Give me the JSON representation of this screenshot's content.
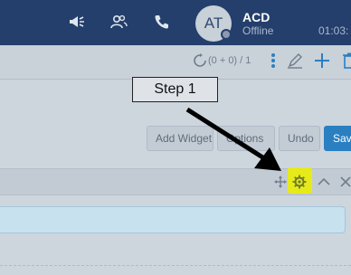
{
  "topbar": {
    "avatar_initials": "AT",
    "user_name": "ACD",
    "user_status": "Offline",
    "clock": "01:03:",
    "icons": [
      "megaphone-icon",
      "contacts-icon",
      "phone-icon"
    ]
  },
  "toolbar": {
    "counter": "(0 + 0) / 1",
    "icons": [
      "refresh-icon",
      "more-vertical-icon",
      "pencil-icon",
      "plus-icon",
      "trash-icon"
    ]
  },
  "buttons": {
    "add_widget": "Add Widget",
    "options": "Options",
    "undo": "Undo",
    "save": "Save"
  },
  "widget_header": {
    "icons": [
      "move-icon",
      "gear-icon",
      "chevron-up-icon",
      "close-icon"
    ]
  },
  "annotation": {
    "label": "Step 1"
  },
  "colors": {
    "topbar": "#243f6b",
    "primary_button": "#2a7fc1",
    "highlight": "#e6ea1a"
  }
}
